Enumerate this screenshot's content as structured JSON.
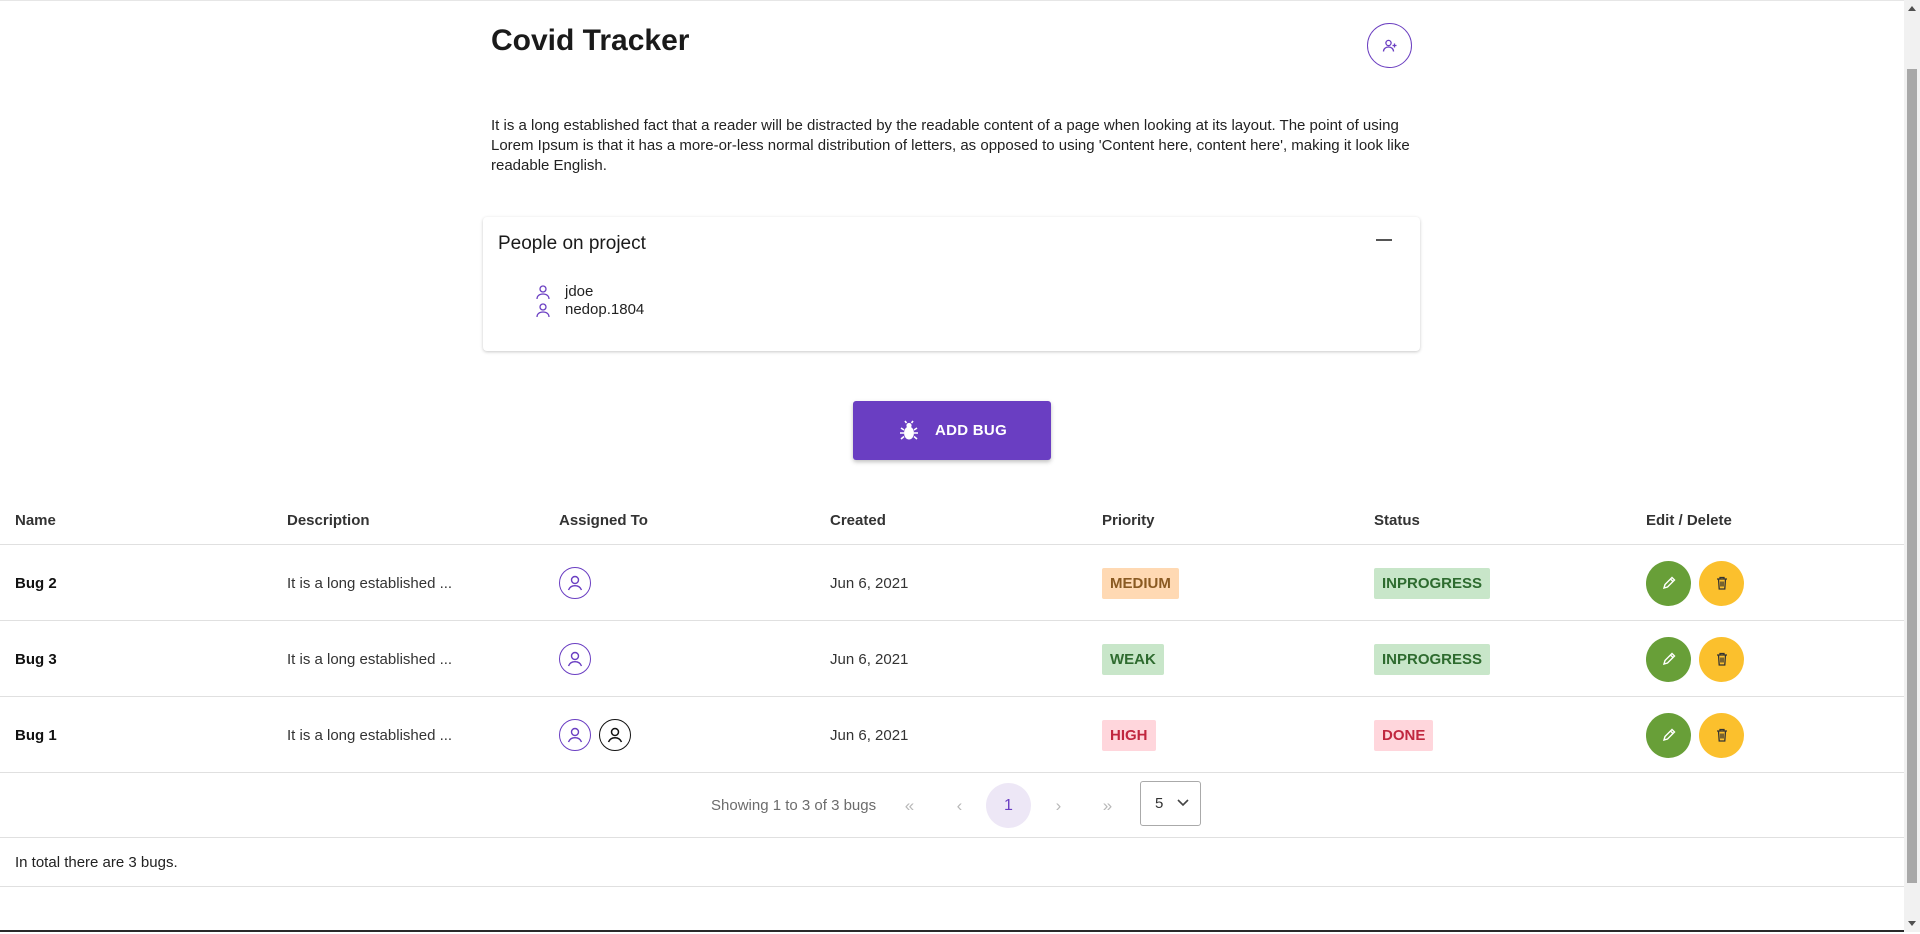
{
  "header": {
    "title": "Covid Tracker",
    "add_user_icon": "person-add-icon"
  },
  "description": "It is a long established fact that a reader will be distracted by the readable content of a page when looking at its layout. The point of using Lorem Ipsum is that it has a more-or-less normal distribution of letters, as opposed to using 'Content here, content here', making it look like readable English.",
  "people": {
    "title": "People on project",
    "members": [
      "jdoe",
      "nedop.1804"
    ]
  },
  "add_bug": {
    "label": "ADD BUG",
    "icon": "bug-icon"
  },
  "table": {
    "headers": [
      "Name",
      "Description",
      "Assigned To",
      "Created",
      "Priority",
      "Status",
      "Edit / Delete"
    ],
    "rows": [
      {
        "name": "Bug 2",
        "description": "It is a long established ...",
        "assignees": 1,
        "created": "Jun 6, 2021",
        "priority": "MEDIUM",
        "status": "INPROGRESS"
      },
      {
        "name": "Bug 3",
        "description": "It is a long established ...",
        "assignees": 1,
        "created": "Jun 6, 2021",
        "priority": "WEAK",
        "status": "INPROGRESS"
      },
      {
        "name": "Bug 1",
        "description": "It is a long established ...",
        "assignees": 2,
        "created": "Jun 6, 2021",
        "priority": "HIGH",
        "status": "DONE"
      }
    ]
  },
  "pagination": {
    "summary": "Showing 1 to 3 of 3 bugs",
    "first": "«",
    "prev": "‹",
    "current_page": "1",
    "next": "›",
    "last": "»",
    "rows_per_page": "5"
  },
  "footer": {
    "total_text": "In total there are 3 bugs."
  },
  "colors": {
    "accent": "#6a3ec2",
    "edit": "#689f38",
    "delete": "#fbc02d"
  }
}
